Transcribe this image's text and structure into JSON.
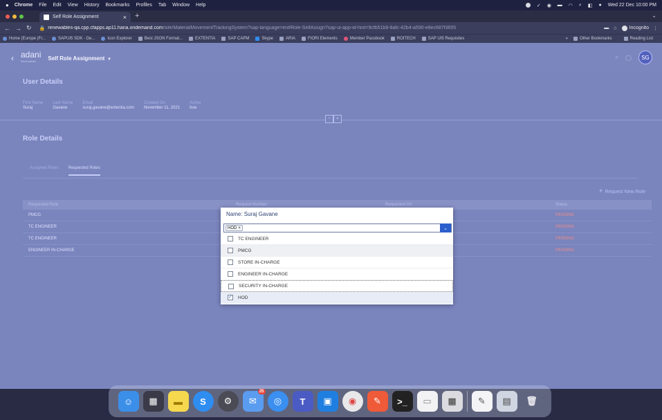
{
  "menubar": {
    "apple": "",
    "items": [
      "Chrome",
      "File",
      "Edit",
      "View",
      "History",
      "Bookmarks",
      "Profiles",
      "Tab",
      "Window",
      "Help"
    ],
    "datetime": "Wed 22 Dec 10:00 PM"
  },
  "browser": {
    "tab_title": "Self Role Assignment",
    "url_host": "renewables-qa.cpp.cfapps.ap11.hana.ondemand.com",
    "url_path": "/site/MaterialMovementTrackingSystem?sap-language=en#Role-SelfAssign?sap-ui-app-id-hint=9cfb51b9-8afc-42b4-a590-e8ec687f3655",
    "incognito_label": "Incognito",
    "bookmarks": [
      "Home (Europe (Fr...",
      "SAPUI5 SDK - De...",
      "Icon Explorer",
      "Best JSON Format...",
      "EXTENTIA",
      "SAP CAPM",
      "Skype",
      "ARIA",
      "FIORI Elements",
      "Member Passbook",
      "ROITECH",
      "SAP UI5 Requisites"
    ],
    "bookmarks_right": [
      "Other Bookmarks",
      "Reading List"
    ]
  },
  "shell": {
    "logo_text": "adani",
    "logo_sub": "Renewables",
    "title": "Self Role Assignment",
    "avatar": "SG"
  },
  "user_details": {
    "title": "User Details",
    "fields": [
      {
        "label": "First Name",
        "value": "Suraj"
      },
      {
        "label": "Last Name",
        "value": "Gavane"
      },
      {
        "label": "Email",
        "value": "suraj.gavane@extentia.com"
      },
      {
        "label": "Created On",
        "value": "November 11, 2021"
      },
      {
        "label": "Active",
        "value": "true"
      }
    ]
  },
  "role_details": {
    "title": "Role Details",
    "tabs": [
      "Assigned Roles",
      "Requested Roles"
    ],
    "request_new": "Request New Role",
    "columns": [
      "Requested Role",
      "Request Number",
      "Requested On",
      "Status"
    ],
    "rows": [
      {
        "role": "PMCG",
        "status": "PENDING"
      },
      {
        "role": "TC ENGINEER",
        "status": "PENDING"
      },
      {
        "role": "TC ENGINEER",
        "status": "PENDING"
      },
      {
        "role": "ENGINEER IN-CHARGE",
        "status": "PENDING"
      }
    ]
  },
  "dialog": {
    "title": "Name: Suraj Gavane",
    "token": "HOD",
    "options": [
      {
        "label": "TC ENGINEER",
        "checked": false
      },
      {
        "label": "PMCG",
        "checked": false
      },
      {
        "label": "STORE IN-CHARGE",
        "checked": false
      },
      {
        "label": "ENGINEER IN-CHARGE",
        "checked": false
      },
      {
        "label": "SECURITY IN-CHARGE",
        "checked": false
      },
      {
        "label": "HOD",
        "checked": true
      }
    ]
  },
  "dock": {
    "badge": "25"
  },
  "colors": {
    "accent": "#2b5fcc",
    "pending": "#c88a9a",
    "app_bg": "#7a84bd"
  }
}
